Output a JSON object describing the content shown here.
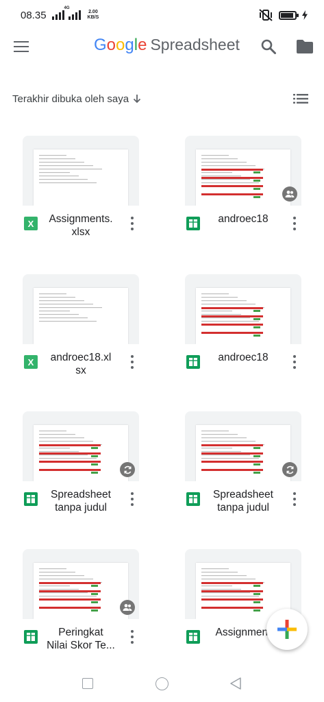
{
  "status_bar": {
    "time": "08.35",
    "network": "4G",
    "speed_value": "2.00",
    "speed_unit": "KB/S"
  },
  "app_bar": {
    "logo_letters": [
      "G",
      "o",
      "o",
      "g",
      "l",
      "e"
    ],
    "logo_colors": [
      "#4285F4",
      "#EA4335",
      "#FBBC05",
      "#4285F4",
      "#34A853",
      "#EA4335"
    ],
    "product_name": "Spreadsheet",
    "icons": [
      "menu-icon",
      "search-icon",
      "folder-icon"
    ]
  },
  "sort": {
    "label": "Terakhir dibuka oleh saya",
    "direction_icon": "arrow-down-icon",
    "view_toggle_icon": "list-view-icon"
  },
  "files": [
    {
      "name": "Assignments.\nxlsx",
      "type": "xlsx",
      "badge": null
    },
    {
      "name": "androec18",
      "type": "sheets",
      "badge": "shared-people-icon"
    },
    {
      "name": "androec18.xl\nsx",
      "type": "xlsx",
      "badge": null
    },
    {
      "name": "androec18",
      "type": "sheets",
      "badge": null
    },
    {
      "name": "Spreadsheet\ntanpa judul",
      "type": "sheets",
      "badge": "sync-icon"
    },
    {
      "name": "Spreadsheet\ntanpa judul",
      "type": "sheets",
      "badge": "sync-icon"
    },
    {
      "name": "Peringkat\nNilai Skor Te...",
      "type": "sheets",
      "badge": "shared-people-icon"
    },
    {
      "name": "Assignment",
      "type": "sheets",
      "badge": null
    }
  ],
  "colors": {
    "sheets_green": "#0f9d58",
    "xlsx_green": "#33b36b",
    "fab_plus": [
      "#4285F4",
      "#EA4335",
      "#FBBC05",
      "#34A853"
    ]
  },
  "fab": {
    "icon": "plus-icon"
  },
  "nav": {
    "icons": [
      "recent-apps-icon",
      "home-icon",
      "back-icon"
    ]
  }
}
